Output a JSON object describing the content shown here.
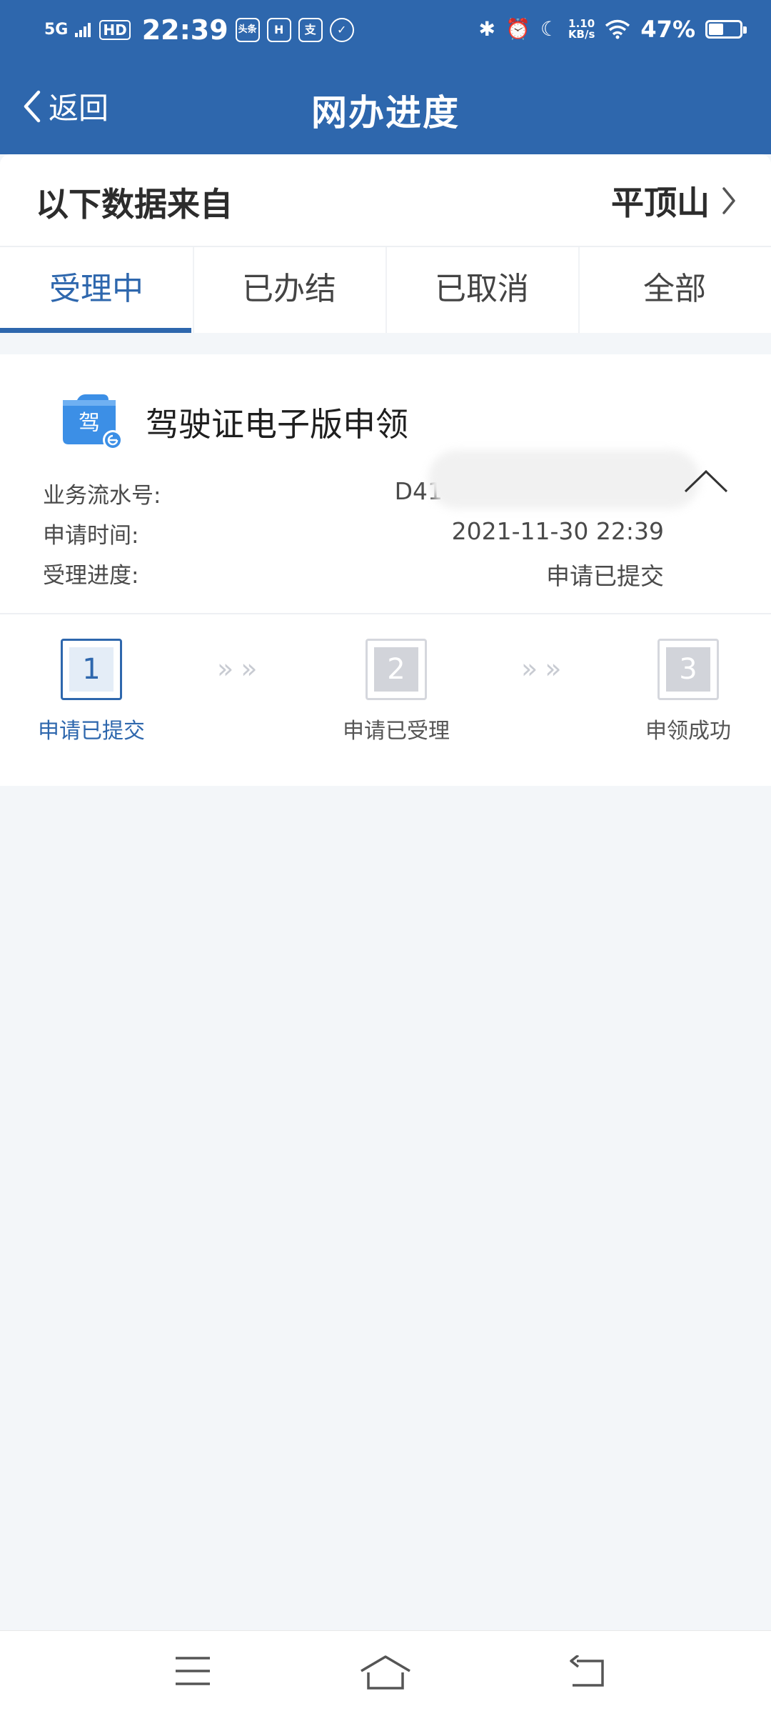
{
  "status_bar": {
    "network": "5G",
    "hd": "HD",
    "time": "22:39",
    "app_icons": [
      "头条",
      "H",
      "支",
      "✓"
    ],
    "speed_value": "1.10",
    "speed_unit": "KB/s",
    "battery_percent": "47%",
    "battery_level": 0.47
  },
  "nav": {
    "back_label": "返回",
    "title": "网办进度"
  },
  "source": {
    "label": "以下数据来自",
    "city": "平顶山"
  },
  "tabs": [
    {
      "label": "受理中",
      "active": true
    },
    {
      "label": "已办结",
      "active": false
    },
    {
      "label": "已取消",
      "active": false
    },
    {
      "label": "全部",
      "active": false
    }
  ],
  "record": {
    "icon_char": "驾",
    "title": "驾驶证电子版申领",
    "serial_label": "业务流水号:",
    "serial_value": "D41",
    "time_label": "申请时间:",
    "time_value": "2021-11-30 22:39",
    "progress_label": "受理进度:",
    "progress_value": "申请已提交",
    "steps": [
      {
        "number": "1",
        "label": "申请已提交"
      },
      {
        "number": "2",
        "label": "申请已受理"
      },
      {
        "number": "3",
        "label": "申领成功"
      }
    ],
    "arrow_glyph": "»»"
  },
  "colors": {
    "primary": "#2e67ad",
    "background": "#f3f6f9",
    "step_inactive": "#d2d4da"
  }
}
